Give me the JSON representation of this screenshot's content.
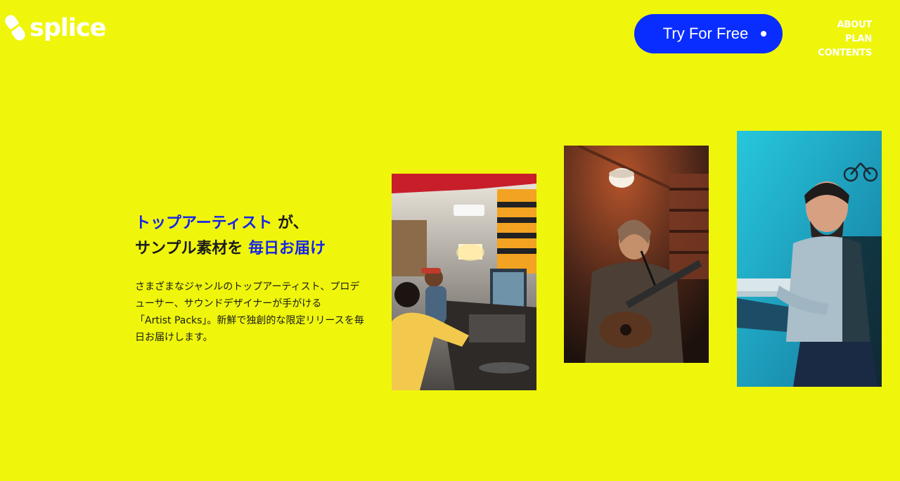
{
  "brand": {
    "name": "splice",
    "logo_icon": "splice-logo-icon",
    "text_color": "#ffffff"
  },
  "header": {
    "cta_label": "Try For Free",
    "cta_icon": "dot-icon",
    "cta_color": "#0a2dff",
    "nav": [
      {
        "label": "ABOUT"
      },
      {
        "label": "PLAN"
      },
      {
        "label": "CONTENTS"
      }
    ]
  },
  "hero": {
    "headline_line1_blue": "トップアーティスト",
    "headline_line1_rest": " が、",
    "headline_line2_black": "サンプル素材を ",
    "headline_line2_blue": "毎日お届け",
    "body": [
      "さまざまなジャンルのトップアーティスト、プロデ",
      "ューサー、サウンドデザイナーが手がける",
      "「Artist Packs」。新鮮で独創的な限定リリースを毎",
      "日お届けします。"
    ],
    "accent_color": "#1725e6"
  },
  "colors": {
    "background": "#eff60b"
  },
  "photos": [
    {
      "subject": "recording-studio-engineers"
    },
    {
      "subject": "singer-with-guitar"
    },
    {
      "subject": "keyboard-player"
    }
  ]
}
